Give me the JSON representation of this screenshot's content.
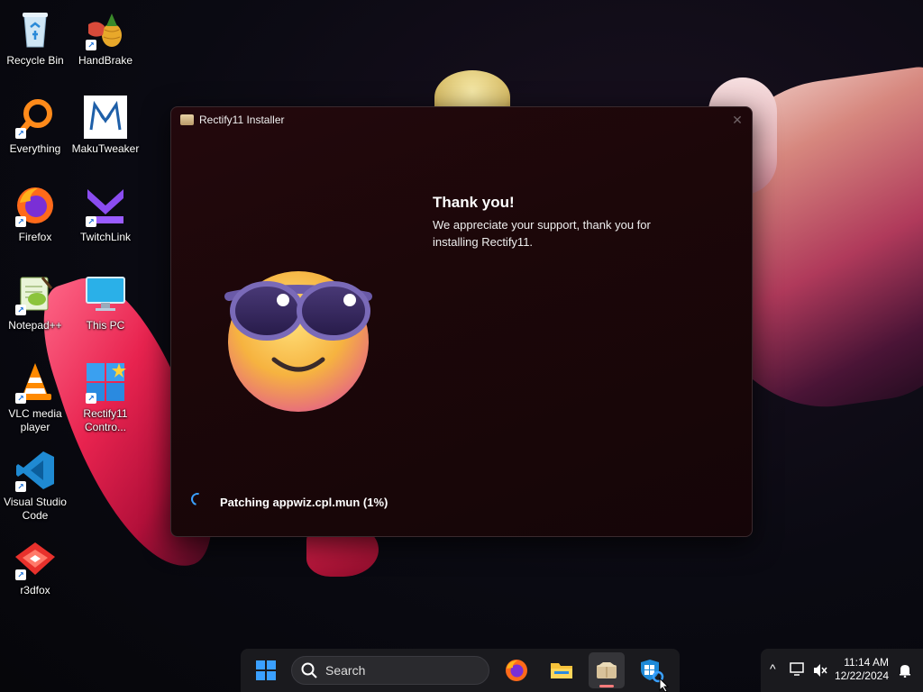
{
  "desktop": {
    "icons": [
      {
        "label": "Recycle Bin"
      },
      {
        "label": "HandBrake"
      },
      {
        "label": "Everything"
      },
      {
        "label": "MakuTweaker"
      },
      {
        "label": "Firefox"
      },
      {
        "label": "TwitchLink"
      },
      {
        "label": "Notepad++"
      },
      {
        "label": "This PC"
      },
      {
        "label": "VLC media player"
      },
      {
        "label": "Rectify11 Contro..."
      },
      {
        "label": "Visual Studio Code"
      },
      {
        "label": "r3dfox"
      }
    ]
  },
  "installer": {
    "title": "Rectify11 Installer",
    "close_glyph": "✕",
    "heading": "Thank you!",
    "message": "We appreciate your support, thank you for installing Rectify11.",
    "status": "Patching appwiz.cpl.mun (1%)",
    "progress_percent": 1
  },
  "taskbar": {
    "search_placeholder": "Search",
    "apps": [
      "start-icon",
      "firefox-icon",
      "file-explorer-icon",
      "rectify11-installer-icon",
      "windows-security-icon"
    ]
  },
  "tray": {
    "time": "11:14 AM",
    "date": "12/22/2024",
    "chevron_glyph": "^"
  },
  "colors": {
    "window_bg": "#1c0709",
    "accent_blue": "#3aa0ff",
    "taskbar_bg": "#1c1c20"
  }
}
